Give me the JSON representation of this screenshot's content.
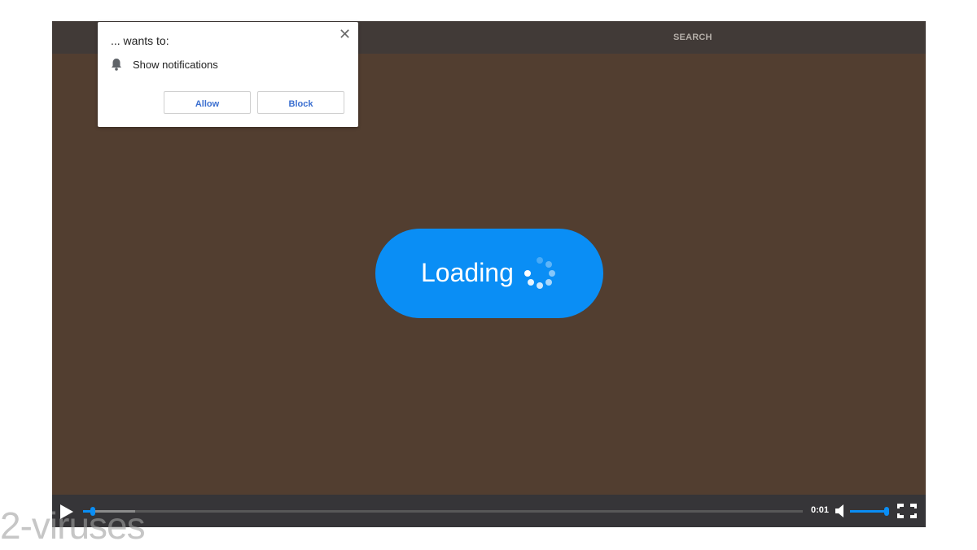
{
  "header": {
    "search_label": "SEARCH"
  },
  "notification_popup": {
    "title": "... wants to:",
    "permission_label": "Show notifications",
    "allow_label": "Allow",
    "block_label": "Block",
    "close_symbol": "✕"
  },
  "video": {
    "loading_label": "Loading",
    "time": "0:01",
    "progress_fraction": 0.014,
    "buffered_fraction": 0.072,
    "volume_fraction": 1.0
  },
  "watermark": {
    "text": "2-viruses"
  },
  "colors": {
    "accent": "#0a8ef5",
    "video_background": "#523e30",
    "topbar": "#413a37",
    "controls": "#363538"
  },
  "icons": [
    "bell-icon",
    "close-icon",
    "play-icon",
    "volume-icon",
    "fullscreen-icon",
    "loading-spinner-icon"
  ]
}
